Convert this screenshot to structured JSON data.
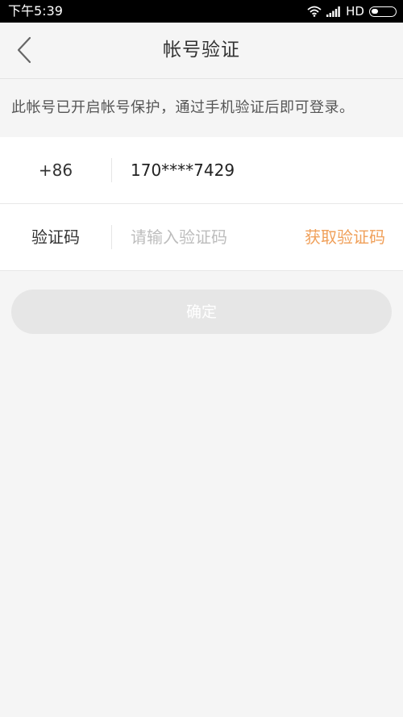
{
  "status_bar": {
    "time": "下午5:39",
    "network": "HD"
  },
  "header": {
    "title": "帐号验证"
  },
  "notice": {
    "text": "此帐号已开启帐号保护，通过手机验证后即可登录。"
  },
  "phone_row": {
    "country_code": "+86",
    "phone_number": "170****7429"
  },
  "code_row": {
    "label": "验证码",
    "placeholder": "请输入验证码",
    "get_code_label": "获取验证码"
  },
  "confirm": {
    "label": "确定"
  },
  "colors": {
    "accent": "#f0a05a",
    "background": "#f5f5f5",
    "disabled_button": "#e6e6e6"
  }
}
